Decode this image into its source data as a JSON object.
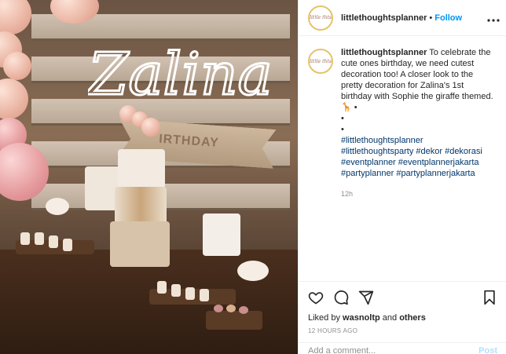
{
  "post": {
    "username": "littlethoughtsplanner",
    "follow_label": "Follow",
    "separator": "•",
    "avatar_text": "little thts",
    "caption_text": "To celebrate the cute ones birthday, we need cutest decoration too! A closer look to the pretty decoration for Zalina's 1st birthday with Sophie the giraffe themed. 🦒 •",
    "caption_dots": [
      "•",
      "•"
    ],
    "hashtags": "#littlethoughtsplanner #littlethoughtsparty #dekor #dekorasi #eventplanner #eventplannerjakarta #partyplanner #partyplannerjakarta",
    "time_ago": "12h",
    "liked_prefix": "Liked by",
    "liked_user": "wasnoltp",
    "liked_suffix": "and",
    "liked_others": "others",
    "posted_ago": "12 HOURS AGO",
    "add_comment_placeholder": "Add a comment...",
    "post_label": "Post"
  },
  "photo": {
    "neon_text": "Zalina",
    "banner_text": "IRTHDAY"
  },
  "icons": {
    "more": "more-options-icon",
    "like": "heart-icon",
    "comment": "comment-icon",
    "share": "share-icon",
    "save": "bookmark-icon"
  }
}
